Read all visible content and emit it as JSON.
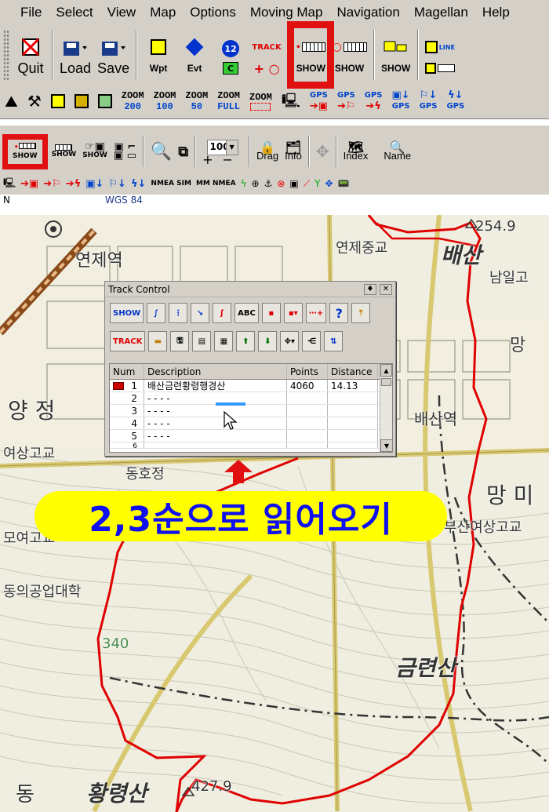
{
  "menu": [
    "File",
    "Select",
    "View",
    "Map",
    "Options",
    "Moving Map",
    "Navigation",
    "Magellan",
    "Help"
  ],
  "main_toolbar": {
    "quit": "Quit",
    "load": "Load",
    "save": "Save",
    "wpt": "Wpt",
    "evt": "Evt",
    "track_label": "TRACK",
    "show1": "SHOW",
    "show2": "SHOW",
    "show3": "SHOW",
    "circle_num": "12",
    "green_box": "C",
    "num_one": "1",
    "line_lbl": "LINE"
  },
  "zoom_toolbar": {
    "zoom_word": "ZOOM",
    "zoom_values": [
      "200",
      "100",
      "50",
      "FULL"
    ],
    "gps": "GPS"
  },
  "second_toolbar": {
    "show_a": "SHOW",
    "show_b": "SHOW",
    "show_c": "SHOW",
    "zoom_value": "100",
    "drag": "Drag",
    "info": "Info",
    "index": "Index",
    "name": "Name",
    "nmea_sim": "NMEA SIM",
    "mm_nmea": "MM NMEA",
    "gps": "GPS"
  },
  "status": {
    "left": "N",
    "datum": "WGS 84"
  },
  "map_labels": {
    "yeonje_station": "연제역",
    "yangjeong": "양 정",
    "yeosang_high": "여상고교",
    "yeongo": "모여고교",
    "dongui": "동의공업대학",
    "dongho": "동호정",
    "yeonje_elem": "연제중교",
    "baesan": "배산",
    "namil": "남일고",
    "baesan_station": "배산역",
    "mang": "망",
    "mang2": "망 미",
    "busan_yeosang": "부산여상고교",
    "geumryeon": "금련산",
    "hwangryeong": "황령산",
    "dong": "동",
    "h254": "254.9",
    "h427": "427.9",
    "h340": "340"
  },
  "dialog": {
    "title": "Track Control",
    "show_btn": "SHOW",
    "track_btn": "TRACK",
    "abc": "ABC",
    "help": "?",
    "columns": [
      "Num",
      "Description",
      "Points",
      "Distance"
    ],
    "rows": [
      {
        "num": "1",
        "desc": "배산금련황령행경산",
        "points": "4060",
        "dist": "14.13",
        "color": "#cc0000"
      },
      {
        "num": "2",
        "desc": "- - - -",
        "points": "",
        "dist": ""
      },
      {
        "num": "3",
        "desc": "- - - -",
        "points": "",
        "dist": ""
      },
      {
        "num": "4",
        "desc": "- - - -",
        "points": "",
        "dist": ""
      },
      {
        "num": "5",
        "desc": "- - - -",
        "points": "",
        "dist": ""
      },
      {
        "num": "6",
        "desc": "",
        "points": "",
        "dist": ""
      }
    ]
  },
  "banner": {
    "text": "2,3순으로 읽어오기"
  },
  "colors": {
    "highlight": "#e01010",
    "track": "#e00000",
    "banner_bg": "#ffff00",
    "banner_text": "#1010ee"
  }
}
